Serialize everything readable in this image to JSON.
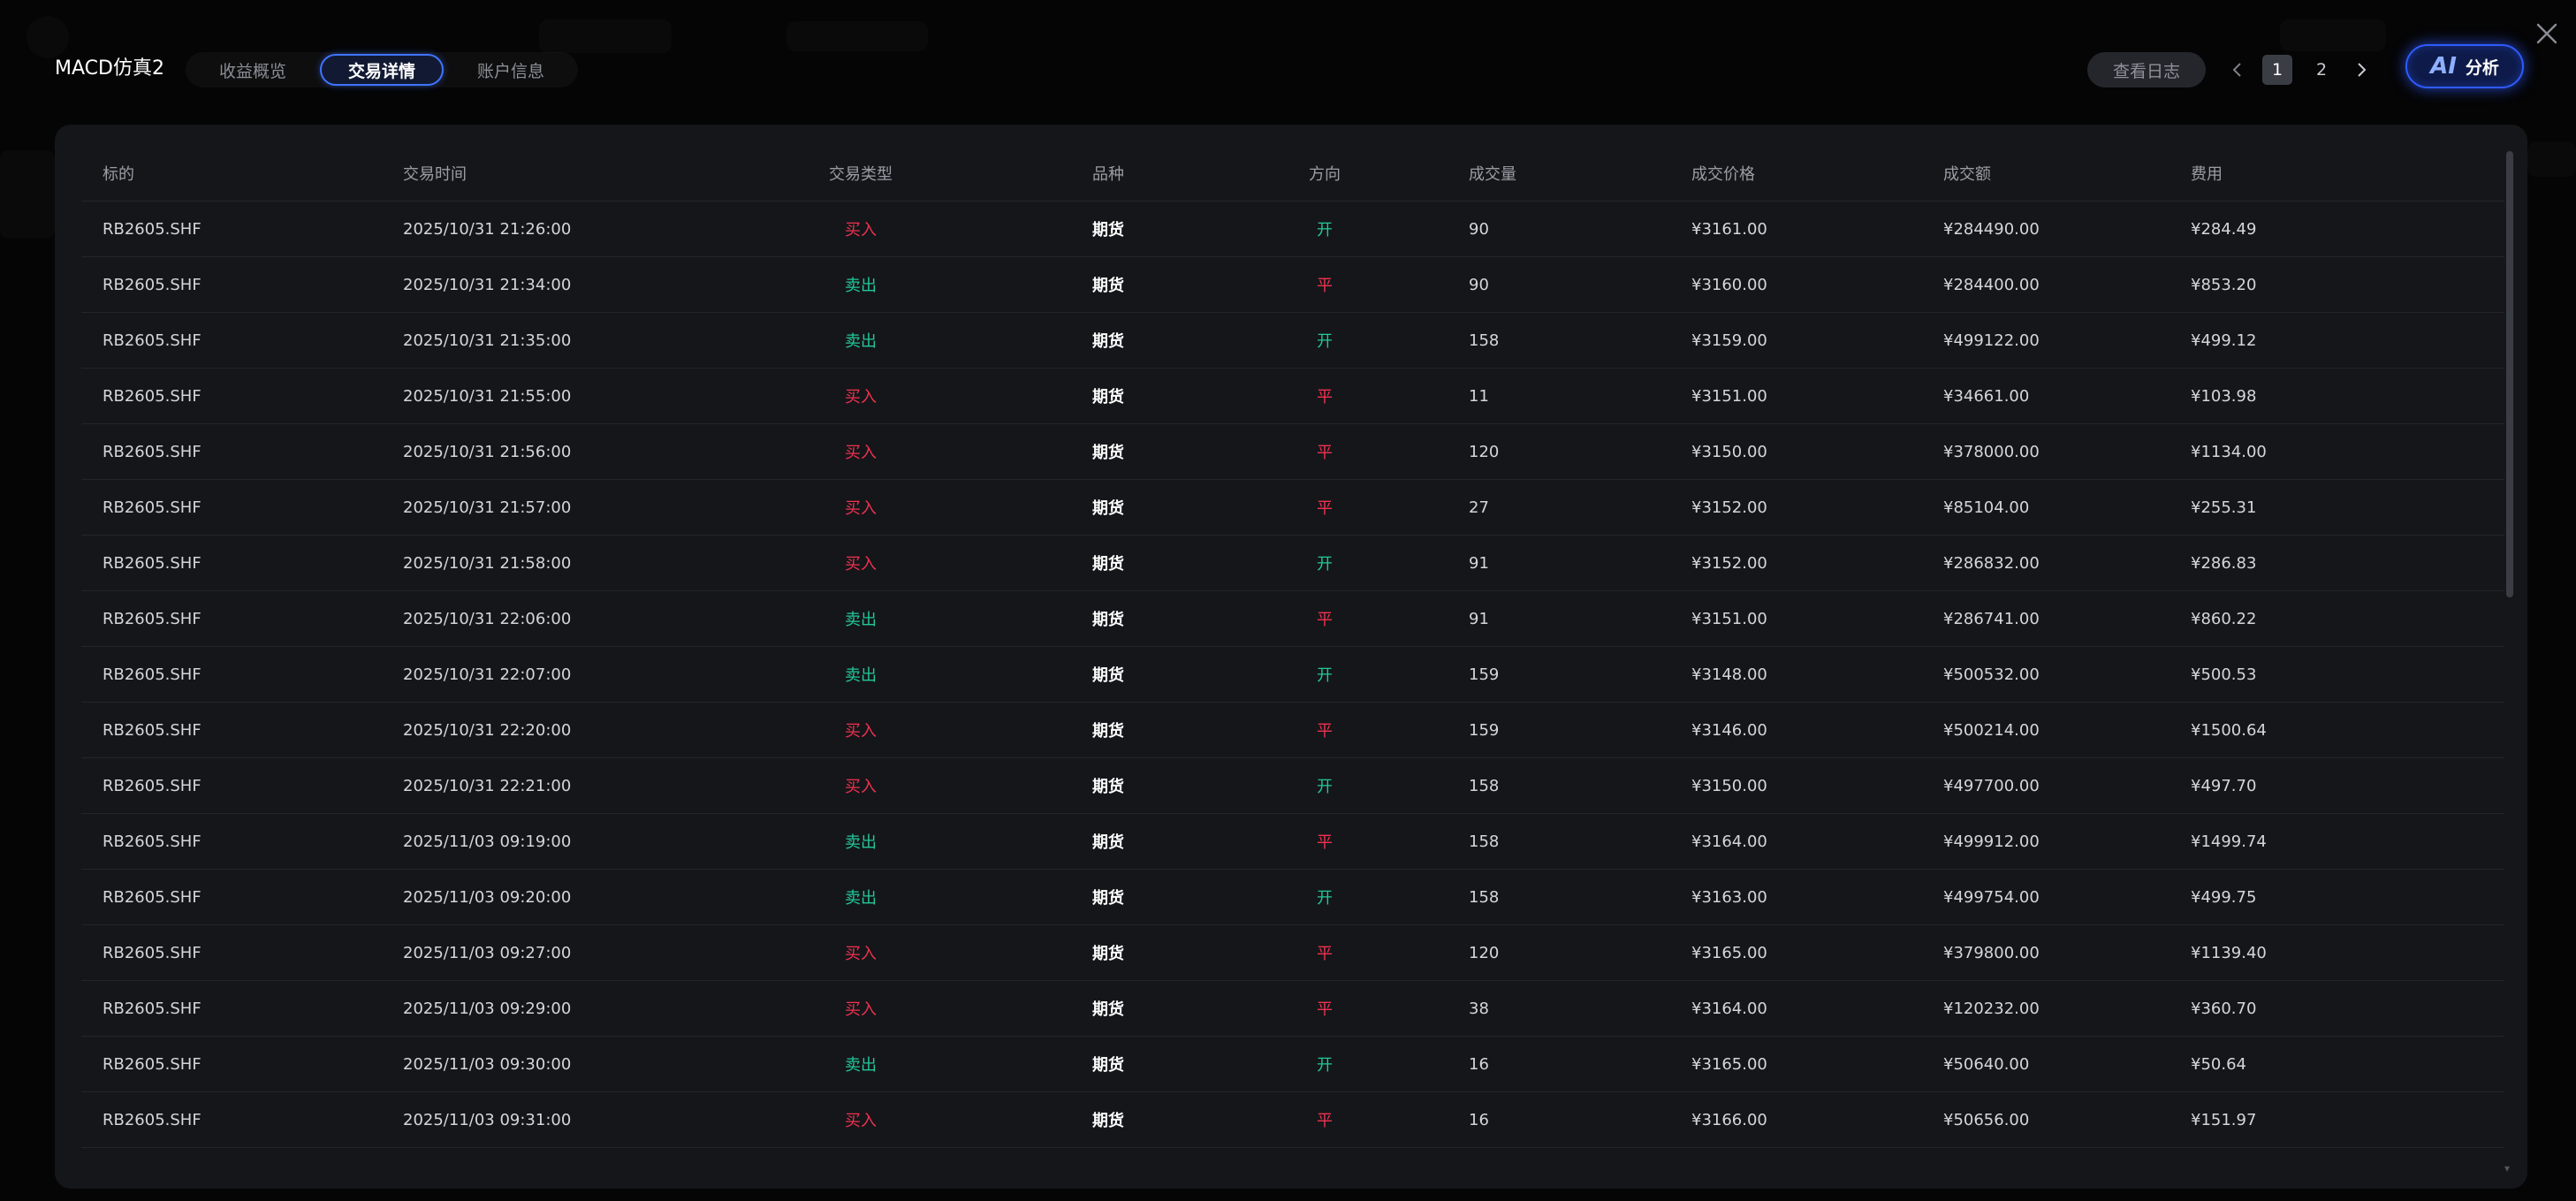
{
  "header": {
    "title": "MACD仿真2",
    "tabs": [
      {
        "label": "收益概览",
        "active": false
      },
      {
        "label": "交易详情",
        "active": true
      },
      {
        "label": "账户信息",
        "active": false
      }
    ],
    "log_button": "查看日志",
    "pagination": {
      "pages": [
        "1",
        "2"
      ],
      "current": "1"
    },
    "ai_button": {
      "glyph": "AI",
      "label": "分析"
    }
  },
  "icons": {
    "close": "close-icon",
    "prev": "chevron-left-icon",
    "next": "chevron-right-icon"
  },
  "colors": {
    "buy": "#f0324f",
    "sell": "#22c79a",
    "accent": "#3f74ff"
  },
  "table": {
    "columns": [
      "标的",
      "交易时间",
      "交易类型",
      "品种",
      "方向",
      "成交量",
      "成交价格",
      "成交额",
      "费用"
    ],
    "rows": [
      [
        "RB2605.SHF",
        "2025/10/31 21:26:00",
        "买入",
        "期货",
        "开",
        "90",
        "¥3161.00",
        "¥284490.00",
        "¥284.49"
      ],
      [
        "RB2605.SHF",
        "2025/10/31 21:34:00",
        "卖出",
        "期货",
        "平",
        "90",
        "¥3160.00",
        "¥284400.00",
        "¥853.20"
      ],
      [
        "RB2605.SHF",
        "2025/10/31 21:35:00",
        "卖出",
        "期货",
        "开",
        "158",
        "¥3159.00",
        "¥499122.00",
        "¥499.12"
      ],
      [
        "RB2605.SHF",
        "2025/10/31 21:55:00",
        "买入",
        "期货",
        "平",
        "11",
        "¥3151.00",
        "¥34661.00",
        "¥103.98"
      ],
      [
        "RB2605.SHF",
        "2025/10/31 21:56:00",
        "买入",
        "期货",
        "平",
        "120",
        "¥3150.00",
        "¥378000.00",
        "¥1134.00"
      ],
      [
        "RB2605.SHF",
        "2025/10/31 21:57:00",
        "买入",
        "期货",
        "平",
        "27",
        "¥3152.00",
        "¥85104.00",
        "¥255.31"
      ],
      [
        "RB2605.SHF",
        "2025/10/31 21:58:00",
        "买入",
        "期货",
        "开",
        "91",
        "¥3152.00",
        "¥286832.00",
        "¥286.83"
      ],
      [
        "RB2605.SHF",
        "2025/10/31 22:06:00",
        "卖出",
        "期货",
        "平",
        "91",
        "¥3151.00",
        "¥286741.00",
        "¥860.22"
      ],
      [
        "RB2605.SHF",
        "2025/10/31 22:07:00",
        "卖出",
        "期货",
        "开",
        "159",
        "¥3148.00",
        "¥500532.00",
        "¥500.53"
      ],
      [
        "RB2605.SHF",
        "2025/10/31 22:20:00",
        "买入",
        "期货",
        "平",
        "159",
        "¥3146.00",
        "¥500214.00",
        "¥1500.64"
      ],
      [
        "RB2605.SHF",
        "2025/10/31 22:21:00",
        "买入",
        "期货",
        "开",
        "158",
        "¥3150.00",
        "¥497700.00",
        "¥497.70"
      ],
      [
        "RB2605.SHF",
        "2025/11/03 09:19:00",
        "卖出",
        "期货",
        "平",
        "158",
        "¥3164.00",
        "¥499912.00",
        "¥1499.74"
      ],
      [
        "RB2605.SHF",
        "2025/11/03 09:20:00",
        "卖出",
        "期货",
        "开",
        "158",
        "¥3163.00",
        "¥499754.00",
        "¥499.75"
      ],
      [
        "RB2605.SHF",
        "2025/11/03 09:27:00",
        "买入",
        "期货",
        "平",
        "120",
        "¥3165.00",
        "¥379800.00",
        "¥1139.40"
      ],
      [
        "RB2605.SHF",
        "2025/11/03 09:29:00",
        "买入",
        "期货",
        "平",
        "38",
        "¥3164.00",
        "¥120232.00",
        "¥360.70"
      ],
      [
        "RB2605.SHF",
        "2025/11/03 09:30:00",
        "卖出",
        "期货",
        "开",
        "16",
        "¥3165.00",
        "¥50640.00",
        "¥50.64"
      ],
      [
        "RB2605.SHF",
        "2025/11/03 09:31:00",
        "买入",
        "期货",
        "平",
        "16",
        "¥3166.00",
        "¥50656.00",
        "¥151.97"
      ]
    ]
  }
}
